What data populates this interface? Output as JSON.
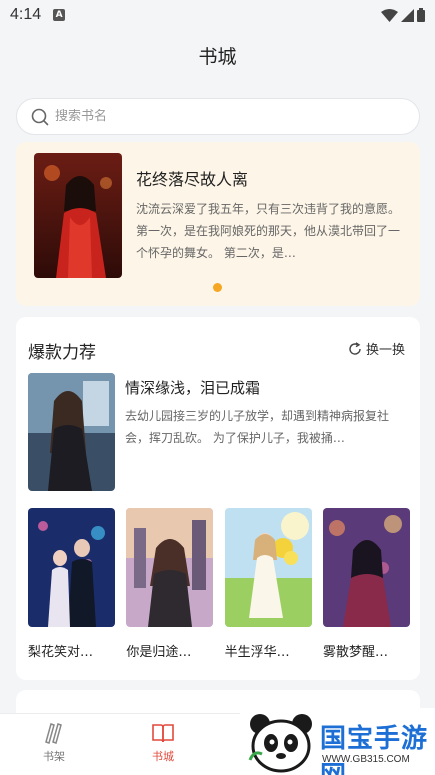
{
  "status_bar": {
    "time": "4:14",
    "app_badge": "A"
  },
  "header": {
    "title": "书城"
  },
  "search": {
    "placeholder": "搜索书名"
  },
  "banner": {
    "title": "花终落尽故人离",
    "description": "沈流云深爱了我五年，只有三次违背了我的意愿。 第一次，是在我阿娘死的那天，他从漠北带回了一个怀孕的舞女。 第二次，是…"
  },
  "hot_section": {
    "title": "爆款力荐",
    "refresh_label": "换一换",
    "featured": {
      "title": "情深缘浅，泪已成霜",
      "description": "去幼儿园接三岁的儿子放学，却遇到精神病报复社会，挥刀乱砍。 为了保护儿子，我被捅…"
    },
    "books": [
      {
        "title": "梨花笑对…"
      },
      {
        "title": "你是归途…"
      },
      {
        "title": "半生浮华…"
      },
      {
        "title": "雾散梦醒…"
      }
    ]
  },
  "bottom_nav": {
    "items": [
      {
        "label": "书架"
      },
      {
        "label": "书城"
      }
    ]
  },
  "watermark": {
    "brand": "国宝手游网",
    "url": "WWW.GB315.COM"
  },
  "colors": {
    "accent": "#e2493b",
    "banner_bg": "#fdf6e8",
    "dot": "#f5a623",
    "watermark_blue": "#1d6fd6"
  }
}
